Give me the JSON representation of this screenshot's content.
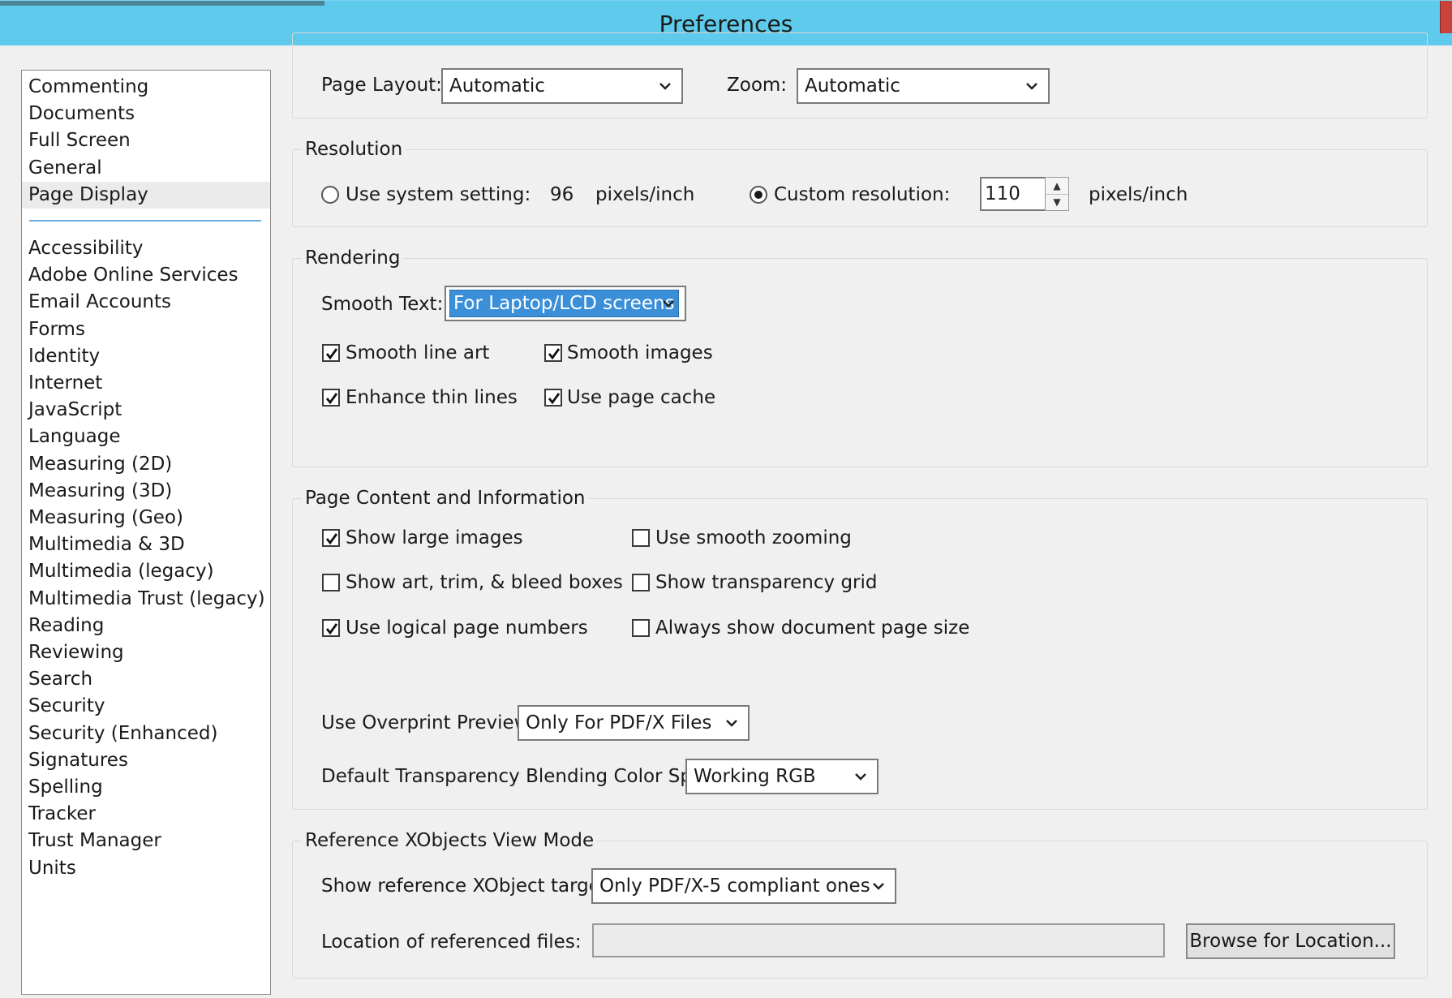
{
  "window": {
    "title": "Preferences"
  },
  "sidebar": {
    "items_top": [
      "Commenting",
      "Documents",
      "Full Screen",
      "General",
      "Page Display"
    ],
    "selected": "Page Display",
    "items_bottom": [
      "Accessibility",
      "Adobe Online Services",
      "Email Accounts",
      "Forms",
      "Identity",
      "Internet",
      "JavaScript",
      "Language",
      "Measuring (2D)",
      "Measuring (3D)",
      "Measuring (Geo)",
      "Multimedia & 3D",
      "Multimedia (legacy)",
      "Multimedia Trust (legacy)",
      "Reading",
      "Reviewing",
      "Search",
      "Security",
      "Security (Enhanced)",
      "Signatures",
      "Spelling",
      "Tracker",
      "Trust Manager",
      "Units"
    ]
  },
  "layout_group": {
    "page_layout_label": "Page Layout:",
    "page_layout_value": "Automatic",
    "zoom_label": "Zoom:",
    "zoom_value": "Automatic"
  },
  "resolution": {
    "title": "Resolution",
    "system_label": "Use system setting:",
    "system_value": "96",
    "system_unit": "pixels/inch",
    "system_selected": false,
    "custom_label": "Custom resolution:",
    "custom_value": "110",
    "custom_unit": "pixels/inch",
    "custom_selected": true
  },
  "rendering": {
    "title": "Rendering",
    "smooth_text_label": "Smooth Text:",
    "smooth_text_value": "For Laptop/LCD screens",
    "smooth_line_art": "Smooth line art",
    "smooth_images": "Smooth images",
    "enhance_thin_lines": "Enhance thin lines",
    "use_page_cache": "Use page cache"
  },
  "page_content": {
    "title": "Page Content and Information",
    "show_large_images": "Show large images",
    "use_smooth_zooming": "Use smooth zooming",
    "show_art_trim": "Show art, trim, & bleed boxes",
    "show_transparency_grid": "Show transparency grid",
    "use_logical_page_numbers": "Use logical page numbers",
    "always_show_page_size": "Always show document page size",
    "overprint_label": "Use Overprint Preview:",
    "overprint_value": "Only For PDF/X Files",
    "blending_label": "Default Transparency Blending Color Space:",
    "blending_value": "Working RGB"
  },
  "xobjects": {
    "title": "Reference XObjects View Mode",
    "targets_label": "Show reference XObject targets:",
    "targets_value": "Only PDF/X-5 compliant ones",
    "location_label": "Location of referenced files:",
    "location_value": "",
    "browse_label": "Browse for Location..."
  },
  "checkbox_states": {
    "smooth_line_art": true,
    "smooth_images": true,
    "enhance_thin_lines": true,
    "use_page_cache": true,
    "show_large_images": true,
    "use_smooth_zooming": false,
    "show_art_trim": false,
    "show_transparency_grid": false,
    "use_logical_page_numbers": true,
    "always_show_page_size": false
  },
  "colors": {
    "titlebar": "#5ecbec",
    "selection": "#3b8fd9",
    "divider": "#6aaee0"
  }
}
